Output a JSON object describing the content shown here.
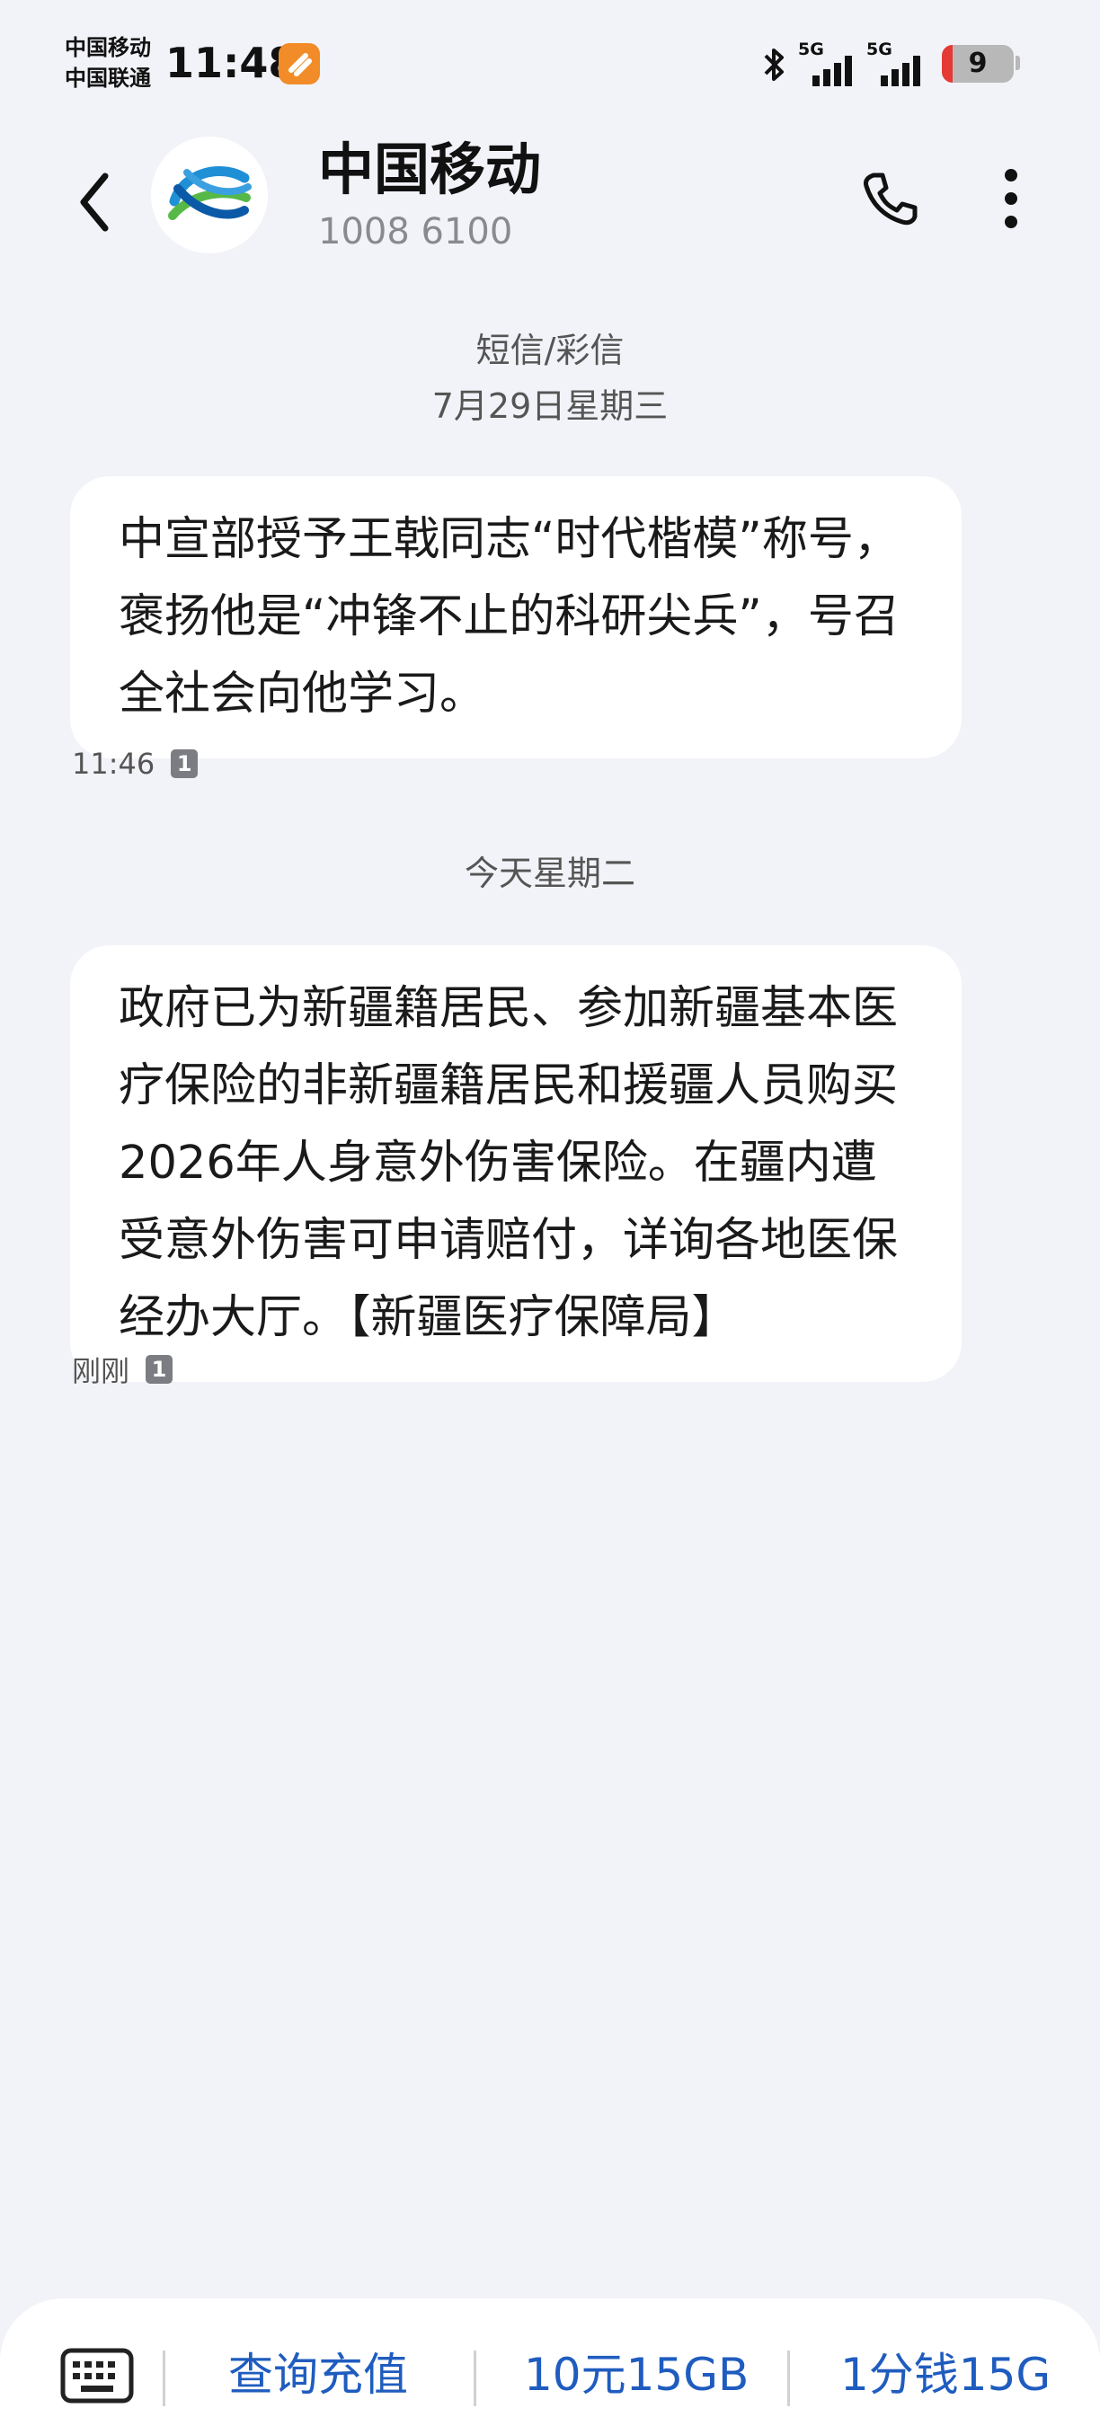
{
  "status_bar": {
    "carrier_1": "中国移动",
    "carrier_2": "中国联通",
    "time": "11:48",
    "network_1": "5G",
    "network_2": "5G",
    "battery_level": "9",
    "icons": [
      "app-notification-icon",
      "bluetooth-icon",
      "signal-icon",
      "battery-icon"
    ]
  },
  "header": {
    "contact_name": "中国移动",
    "contact_number": "1008 6100",
    "icons": [
      "back-arrow-icon",
      "china-mobile-logo",
      "phone-icon",
      "more-vertical-icon"
    ],
    "logo_colors": [
      "#1f8fd6",
      "#56b947",
      "#0b5aa8"
    ]
  },
  "conversation": {
    "type_label": "短信/彩信",
    "groups": [
      {
        "date_label": "7月29日星期三",
        "message": {
          "text": "中宣部授予王戟同志“时代楷模”称号，褒扬他是“冲锋不止的科研尖兵”，号召全社会向他学习。",
          "time": "11:46",
          "sim": "1"
        }
      },
      {
        "date_label": "今天星期二",
        "message": {
          "text": "政府已为新疆籍居民、参加新疆基本医疗保险的非新疆籍居民和援疆人员购买2026年人身意外伤害保险。在疆内遭受意外伤害可申请赔付，详询各地医保经办大厅。【新疆医疗保障局】",
          "time": "刚刚",
          "sim": "1"
        }
      }
    ]
  },
  "quick_replies": [
    "查询充值",
    "10元15GB",
    "1分钱15G"
  ],
  "colors": {
    "background": "#f2f3f8",
    "bubble": "#ffffff",
    "accent": "#1f5cbf",
    "battery_low": "#e53935",
    "app_icon": "#f28c28"
  }
}
